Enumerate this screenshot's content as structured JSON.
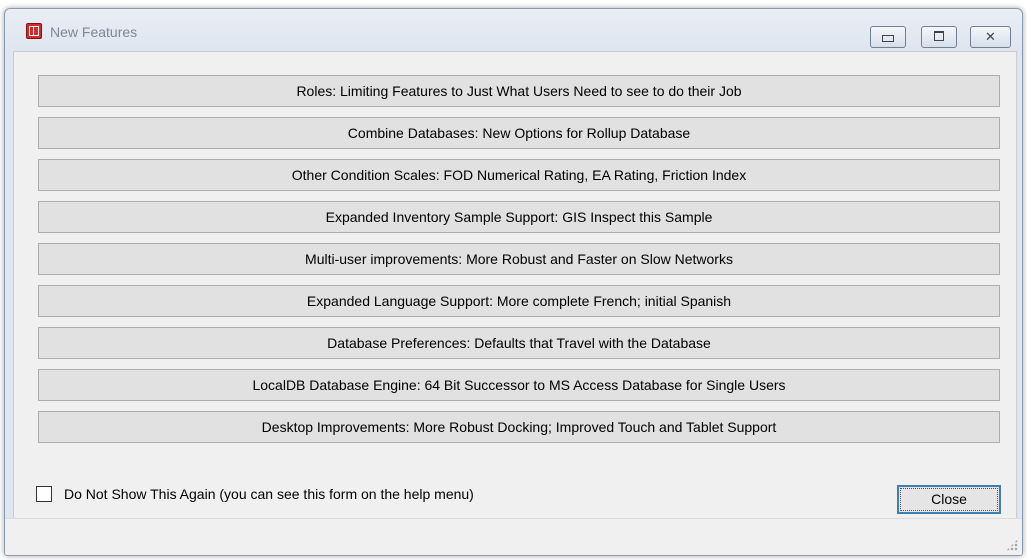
{
  "window": {
    "title": "New Features",
    "minimize_icon": "minimize-icon",
    "maximize_icon": "maximize-icon",
    "close_icon": "close-x-icon",
    "close_glyph": "✕"
  },
  "features": [
    "Roles: Limiting Features to Just What Users Need to see to do their Job",
    "Combine Databases: New Options for Rollup Database",
    "Other Condition Scales: FOD Numerical Rating, EA Rating, Friction Index",
    "Expanded Inventory Sample Support: GIS Inspect this Sample",
    "Multi-user improvements: More Robust and Faster on Slow Networks",
    "Expanded Language Support: More complete French; initial Spanish",
    "Database Preferences: Defaults that Travel with the Database",
    "LocalDB Database Engine: 64 Bit Successor to MS Access Database for Single Users",
    "Desktop Improvements: More Robust Docking; Improved Touch and Tablet Support"
  ],
  "footer": {
    "checkbox_label": "Do Not Show This Again (you can see this form on the help menu)",
    "checkbox_checked": false,
    "close_label": "Close"
  },
  "colors": {
    "app_icon": "#d12b2b",
    "default_button_border": "#3c7fb1"
  }
}
